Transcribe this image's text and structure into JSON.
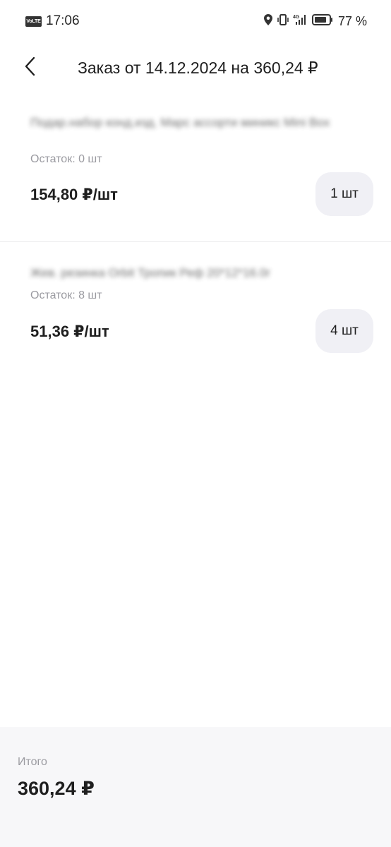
{
  "status_bar": {
    "network_badge": "VoLTE",
    "time": "17:06",
    "icons": [
      "location-icon",
      "vibrate-icon",
      "signal-4g-icon",
      "battery-icon"
    ],
    "battery_percent": "77 %"
  },
  "header": {
    "back_icon": "chevron-left-icon",
    "title": "Заказ от 14.12.2024 на 360,24 ₽"
  },
  "items": [
    {
      "name": "Подар.набор конд.изд. Марс ассорти миникс Mini Box",
      "stock": "Остаток: 0 шт",
      "price": "154,80 ₽/шт",
      "quantity": "1 шт"
    },
    {
      "name": "Жев. резинка Orbit Тропик Реф 20*12*16.0г",
      "stock": "Остаток: 8 шт",
      "price": "51,36 ₽/шт",
      "quantity": "4 шт"
    }
  ],
  "footer": {
    "total_label": "Итого",
    "total_value": "360,24 ₽"
  },
  "colors": {
    "background": "#ffffff",
    "text_primary": "#1f1f1f",
    "text_secondary": "#9a9aa0",
    "pill_background": "#f0f0f5",
    "footer_background": "#f7f7f9"
  }
}
